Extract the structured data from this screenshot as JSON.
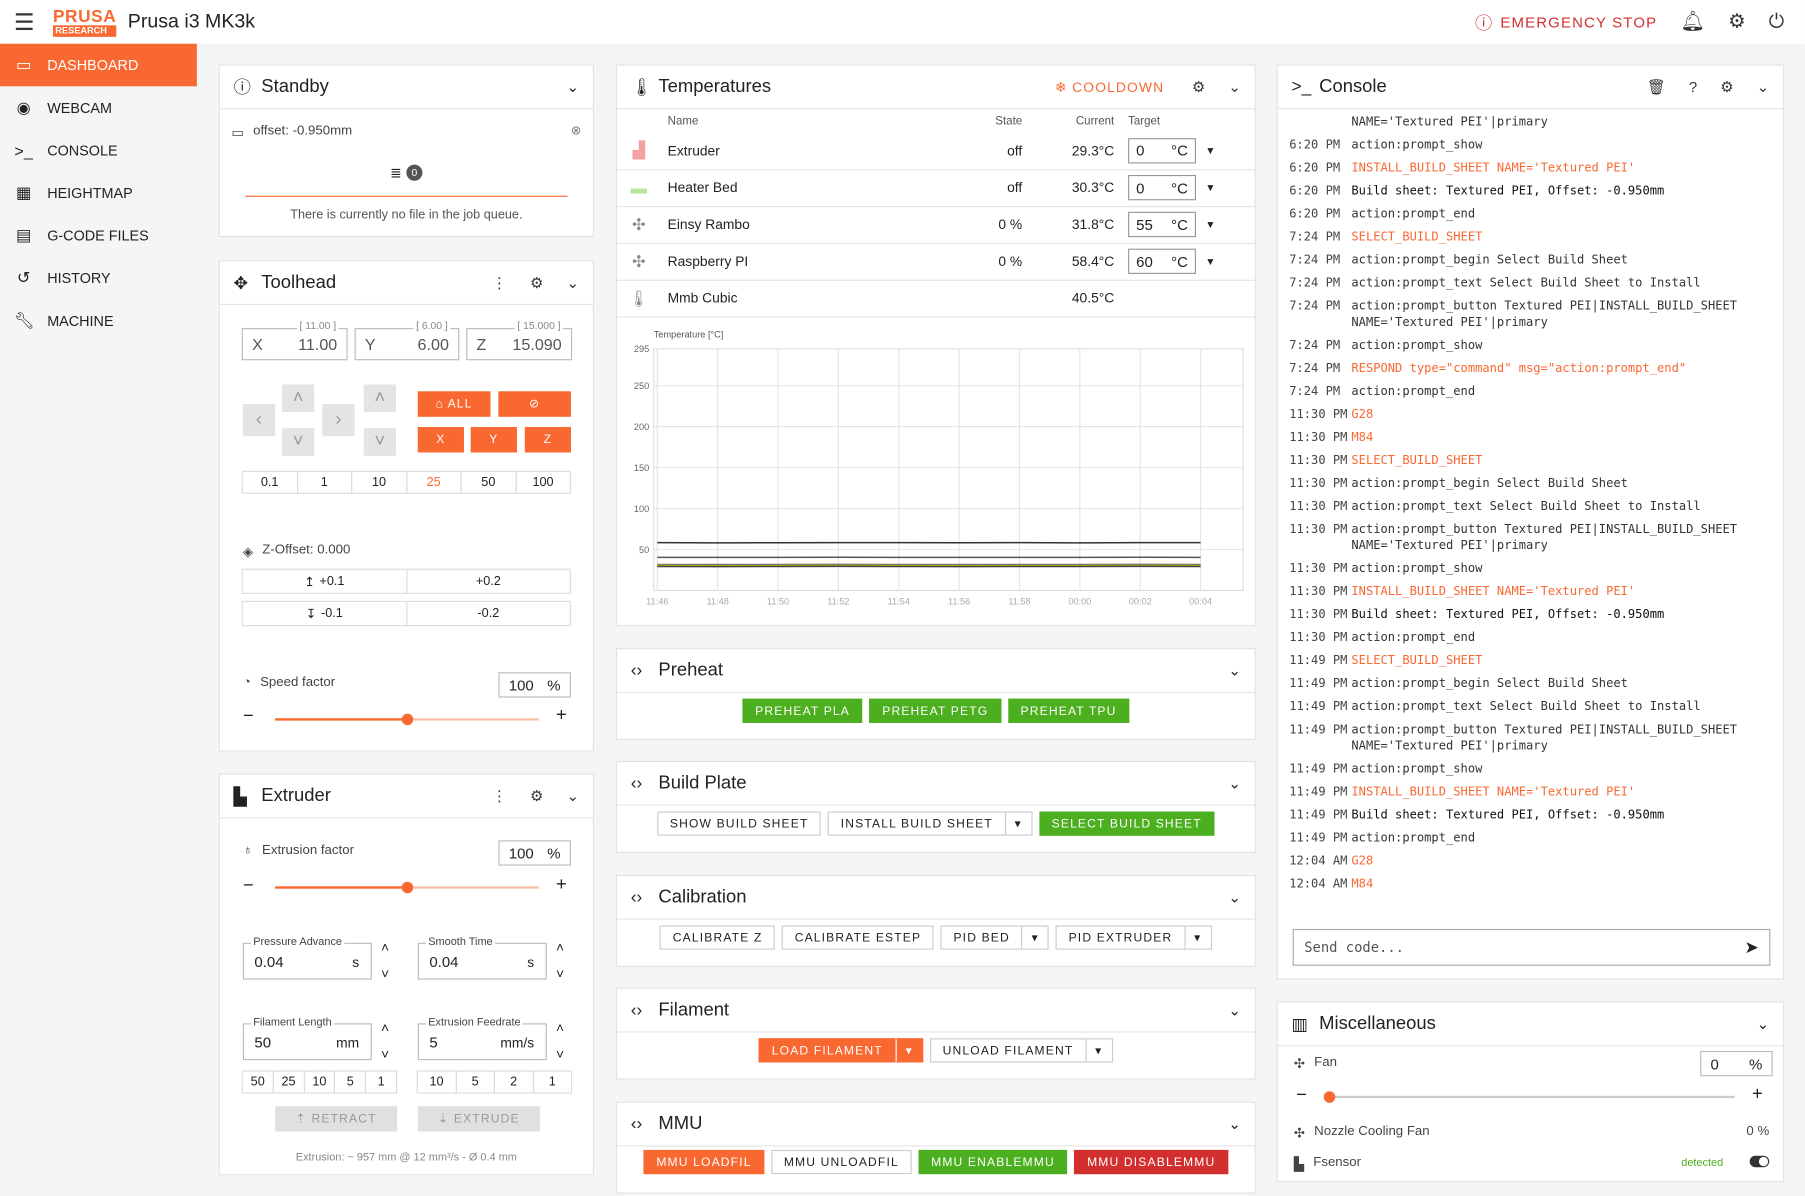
{
  "app": {
    "logo_top": "PRUSA",
    "logo_bottom": "RESEARCH",
    "title": "Prusa i3 MK3k",
    "emergency": "EMERGENCY STOP"
  },
  "nav": [
    {
      "label": "DASHBOARD",
      "icon": "monitor-icon"
    },
    {
      "label": "WEBCAM",
      "icon": "webcam-icon"
    },
    {
      "label": "CONSOLE",
      "icon": "console-icon"
    },
    {
      "label": "HEIGHTMAP",
      "icon": "grid-icon"
    },
    {
      "label": "G-CODE FILES",
      "icon": "file-icon"
    },
    {
      "label": "HISTORY",
      "icon": "history-icon"
    },
    {
      "label": "MACHINE",
      "icon": "wrench-icon"
    }
  ],
  "standby": {
    "title": "Standby",
    "offset": "offset: -0.950mm",
    "queue_count": "0",
    "empty": "There is currently no file in the job queue."
  },
  "toolhead": {
    "title": "Toolhead",
    "x_max": "[ 11.00 ]",
    "y_max": "[ 6.00 ]",
    "z_max": "[ 15.000 ]",
    "x_label": "X",
    "y_label": "Y",
    "z_label": "Z",
    "x_val": "11.00",
    "y_val": "6.00",
    "z_val": "15.090",
    "home_all": "ALL",
    "home_x": "X",
    "home_y": "Y",
    "home_z": "Z",
    "steps": [
      "0.1",
      "1",
      "10",
      "25",
      "50",
      "100"
    ],
    "zoffset": "Z-Offset: 0.000",
    "z_up1": "+0.1",
    "z_up2": "+0.2",
    "z_dn1": "-0.1",
    "z_dn2": "-0.2",
    "speed_label": "Speed factor",
    "speed_val": "100",
    "speed_unit": "%",
    "speed_fraction": 0.5,
    "minus": "−",
    "plus": "+"
  },
  "extruder": {
    "title": "Extruder",
    "factor_label": "Extrusion factor",
    "factor_val": "100",
    "factor_unit": "%",
    "factor_fraction": 0.5,
    "pa_label": "Pressure Advance",
    "pa_val": "0.04",
    "pa_unit": "s",
    "st_label": "Smooth Time",
    "st_val": "0.04",
    "st_unit": "s",
    "fl_label": "Filament Length",
    "fl_val": "50",
    "fl_unit": "mm",
    "ef_label": "Extrusion Feedrate",
    "ef_val": "5",
    "ef_unit": "mm/s",
    "len_steps": [
      "50",
      "25",
      "10",
      "5",
      "1"
    ],
    "feed_steps": [
      "10",
      "5",
      "2",
      "1"
    ],
    "retract": "RETRACT",
    "extrude": "EXTRUDE",
    "footer": "Extrusion: ~ 957 mm @ 12 mm³/s - Ø 0.4 mm"
  },
  "temps": {
    "title": "Temperatures",
    "cooldown": "COOLDOWN",
    "cols": [
      "Name",
      "State",
      "Current",
      "Target"
    ],
    "rows": [
      {
        "name": "Extruder",
        "state": "off",
        "current": "29.3°C",
        "target": "0",
        "unit": "°C",
        "icon": "extruder-icon",
        "color": "#f5a0a0"
      },
      {
        "name": "Heater Bed",
        "state": "off",
        "current": "30.3°C",
        "target": "0",
        "unit": "°C",
        "icon": "bed-icon",
        "color": "#b7e39c"
      },
      {
        "name": "Einsy Rambo",
        "state": "0 %",
        "current": "31.8°C",
        "target": "55",
        "unit": "°C",
        "icon": "fan-icon",
        "color": "#888888"
      },
      {
        "name": "Raspberry PI",
        "state": "0 %",
        "current": "58.4°C",
        "target": "60",
        "unit": "°C",
        "icon": "fan-icon",
        "color": "#888888"
      },
      {
        "name": "Mmb Cubic",
        "state": "",
        "current": "40.5°C",
        "target": "",
        "unit": "",
        "icon": "thermometer-icon",
        "color": "#888888"
      }
    ]
  },
  "chart_data": {
    "type": "line",
    "title": "",
    "ylabel": "Temperature [°C]",
    "ylim": [
      0,
      295
    ],
    "yticks": [
      295,
      250,
      200,
      150,
      100,
      50
    ],
    "x": [
      "11:46",
      "11:48",
      "11:50",
      "11:52",
      "11:54",
      "11:56",
      "11:58",
      "00:00",
      "00:02",
      "00:04"
    ],
    "series": [
      {
        "values": [
          58.4,
          58.2,
          58.3,
          58.5,
          58.4,
          58.3,
          58.4,
          58.2,
          58.5,
          58.4
        ],
        "color": "#333333"
      },
      {
        "values": [
          40.5,
          40.4,
          40.5,
          40.6,
          40.5,
          40.4,
          40.5,
          40.5,
          40.6,
          40.5
        ],
        "color": "#555555"
      },
      {
        "values": [
          31.8,
          31.7,
          31.8,
          31.9,
          31.8,
          31.7,
          31.8,
          31.8,
          31.9,
          31.8
        ],
        "color": "#777777"
      },
      {
        "values": [
          30.3,
          30.2,
          30.3,
          30.4,
          30.3,
          30.2,
          30.3,
          30.3,
          30.4,
          30.3
        ],
        "color": "#b5b500"
      },
      {
        "values": [
          29.3,
          29.2,
          29.3,
          29.4,
          29.3,
          29.2,
          29.3,
          29.3,
          29.4,
          29.3
        ],
        "color": "#444444"
      }
    ],
    "grid": true
  },
  "preheat": {
    "title": "Preheat",
    "buttons": [
      "PREHEAT PLA",
      "PREHEAT PETG",
      "PREHEAT TPU"
    ]
  },
  "buildplate": {
    "title": "Build Plate",
    "show": "SHOW BUILD SHEET",
    "install": "INSTALL BUILD SHEET",
    "select": "SELECT BUILD SHEET"
  },
  "calibration": {
    "title": "Calibration",
    "z": "CALIBRATE Z",
    "estep": "CALIBRATE ESTEP",
    "pidbed": "PID BED",
    "pidext": "PID EXTRUDER"
  },
  "filament": {
    "title": "Filament",
    "load": "LOAD FILAMENT",
    "unload": "UNLOAD FILAMENT"
  },
  "mmu": {
    "title": "MMU",
    "loadfil": "MMU LOADFIL",
    "unloadfil": "MMU UNLOADFIL",
    "enable": "MMU ENABLEMMU",
    "disable": "MMU DISABLEMMU"
  },
  "console": {
    "title": "Console",
    "placeholder": "Send code...",
    "lines": [
      {
        "t": "",
        "m": "NAME='Textured PEI'|primary",
        "k": ""
      },
      {
        "t": "6:20 PM",
        "m": "action:prompt_show",
        "k": ""
      },
      {
        "t": "6:20 PM",
        "m": "INSTALL_BUILD_SHEET NAME='Textured PEI'",
        "k": "or"
      },
      {
        "t": "6:20 PM",
        "m": "Build sheet: Textured PEI, Offset: -0.950mm",
        "k": "bl"
      },
      {
        "t": "6:20 PM",
        "m": "action:prompt_end",
        "k": ""
      },
      {
        "t": "7:24 PM",
        "m": "SELECT_BUILD_SHEET",
        "k": "or"
      },
      {
        "t": "7:24 PM",
        "m": "action:prompt_begin Select Build Sheet",
        "k": ""
      },
      {
        "t": "7:24 PM",
        "m": "action:prompt_text Select Build Sheet to Install",
        "k": ""
      },
      {
        "t": "7:24 PM",
        "m": "action:prompt_button Textured PEI|INSTALL_BUILD_SHEET\nNAME='Textured PEI'|primary",
        "k": ""
      },
      {
        "t": "7:24 PM",
        "m": "action:prompt_show",
        "k": ""
      },
      {
        "t": "7:24 PM",
        "m": "RESPOND type=\"command\" msg=\"action:prompt_end\"",
        "k": "or"
      },
      {
        "t": "7:24 PM",
        "m": "action:prompt_end",
        "k": ""
      },
      {
        "t": "11:30 PM",
        "m": "G28",
        "k": "or"
      },
      {
        "t": "11:30 PM",
        "m": "M84",
        "k": "or"
      },
      {
        "t": "11:30 PM",
        "m": "SELECT_BUILD_SHEET",
        "k": "or"
      },
      {
        "t": "11:30 PM",
        "m": "action:prompt_begin Select Build Sheet",
        "k": ""
      },
      {
        "t": "11:30 PM",
        "m": "action:prompt_text Select Build Sheet to Install",
        "k": ""
      },
      {
        "t": "11:30 PM",
        "m": "action:prompt_button Textured PEI|INSTALL_BUILD_SHEET\nNAME='Textured PEI'|primary",
        "k": ""
      },
      {
        "t": "11:30 PM",
        "m": "action:prompt_show",
        "k": ""
      },
      {
        "t": "11:30 PM",
        "m": "INSTALL_BUILD_SHEET NAME='Textured PEI'",
        "k": "or"
      },
      {
        "t": "11:30 PM",
        "m": "Build sheet: Textured PEI, Offset: -0.950mm",
        "k": "bl"
      },
      {
        "t": "11:30 PM",
        "m": "action:prompt_end",
        "k": ""
      },
      {
        "t": "11:49 PM",
        "m": "SELECT_BUILD_SHEET",
        "k": "or"
      },
      {
        "t": "11:49 PM",
        "m": "action:prompt_begin Select Build Sheet",
        "k": ""
      },
      {
        "t": "11:49 PM",
        "m": "action:prompt_text Select Build Sheet to Install",
        "k": ""
      },
      {
        "t": "11:49 PM",
        "m": "action:prompt_button Textured PEI|INSTALL_BUILD_SHEET\nNAME='Textured PEI'|primary",
        "k": ""
      },
      {
        "t": "11:49 PM",
        "m": "action:prompt_show",
        "k": ""
      },
      {
        "t": "11:49 PM",
        "m": "INSTALL_BUILD_SHEET NAME='Textured PEI'",
        "k": "or"
      },
      {
        "t": "11:49 PM",
        "m": "Build sheet: Textured PEI, Offset: -0.950mm",
        "k": "bl"
      },
      {
        "t": "11:49 PM",
        "m": "action:prompt_end",
        "k": ""
      },
      {
        "t": "12:04 AM",
        "m": "G28",
        "k": "or"
      },
      {
        "t": "12:04 AM",
        "m": "M84",
        "k": "or"
      }
    ]
  },
  "misc": {
    "title": "Miscellaneous",
    "fan": "Fan",
    "fan_val": "0",
    "fan_unit": "%",
    "fan_fraction": 0.0,
    "nozzle": "Nozzle Cooling Fan",
    "nozzle_val": "0 %",
    "fsensor": "Fsensor",
    "fsensor_state": "detected"
  },
  "colors": {
    "accent": "#fa6831",
    "green": "#4caf1f",
    "red": "#d32f2f"
  }
}
